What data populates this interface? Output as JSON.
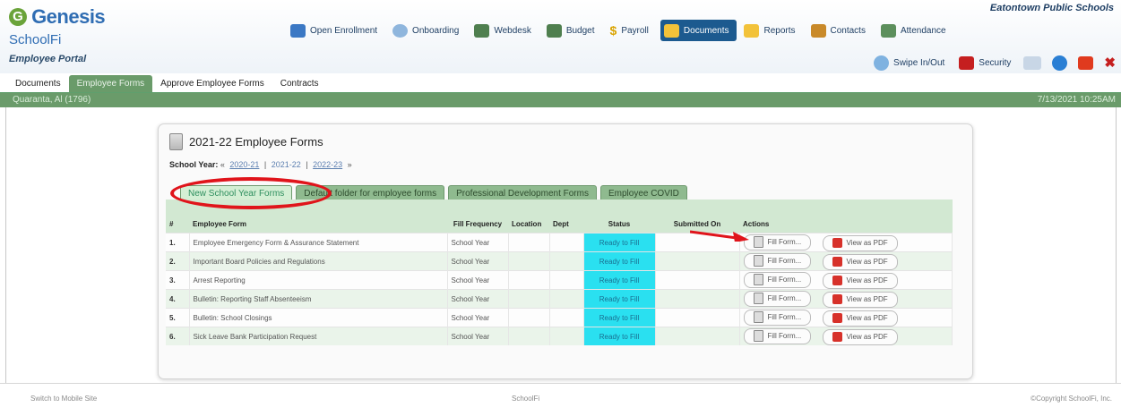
{
  "header": {
    "logo_letter": "G",
    "logo_title": "Genesis",
    "logo_sub": "SchoolFi",
    "portal": "Employee Portal",
    "district": "Eatontown Public Schools",
    "nav": [
      "Open Enrollment",
      "Onboarding",
      "Webdesk",
      "Budget",
      "Payroll",
      "Documents",
      "Reports",
      "Contacts",
      "Attendance"
    ],
    "secondary": [
      "Swipe In/Out",
      "Security"
    ]
  },
  "subtabs": [
    "Documents",
    "Employee Forms",
    "Approve Employee Forms",
    "Contracts"
  ],
  "userbar": {
    "user": "Quaranta, Al  (1796)",
    "datetime": "7/13/2021 10:25AM"
  },
  "panel": {
    "title": "2021-22 Employee Forms",
    "year_label": "School Year:",
    "years": [
      "2020-21",
      "2021-22",
      "2022-23"
    ],
    "folders": [
      "New School Year Forms",
      "Default folder for employee forms",
      "Professional Development Forms",
      "Employee COVID"
    ]
  },
  "table": {
    "headers": [
      "#",
      "Employee Form",
      "Fill Frequency",
      "Location",
      "Dept",
      "Status",
      "Submitted On",
      "Actions"
    ],
    "fill_label": "Fill Form...",
    "pdf_label": "View as PDF",
    "rows": [
      {
        "num": "1.",
        "form": "Employee Emergency Form & Assurance Statement",
        "freq": "School Year",
        "status": "Ready to Fill"
      },
      {
        "num": "2.",
        "form": "Important Board Policies and Regulations",
        "freq": "School Year",
        "status": "Ready to Fill"
      },
      {
        "num": "3.",
        "form": "Arrest Reporting",
        "freq": "School Year",
        "status": "Ready to Fill"
      },
      {
        "num": "4.",
        "form": "Bulletin: Reporting Staff Absenteeism",
        "freq": "School Year",
        "status": "Ready to Fill"
      },
      {
        "num": "5.",
        "form": "Bulletin: School Closings",
        "freq": "School Year",
        "status": "Ready to Fill"
      },
      {
        "num": "6.",
        "form": "Sick Leave Bank Participation Request",
        "freq": "School Year",
        "status": "Ready to Fill"
      }
    ]
  },
  "footer": {
    "left": "Switch to Mobile Site",
    "center": "SchoolFi",
    "right": "©Copyright SchoolFi, Inc."
  },
  "colors": {
    "accent": "#1c5a8f",
    "green": "#6a9b6a",
    "status": "#2ae0f0",
    "annotation": "#e0141b"
  }
}
